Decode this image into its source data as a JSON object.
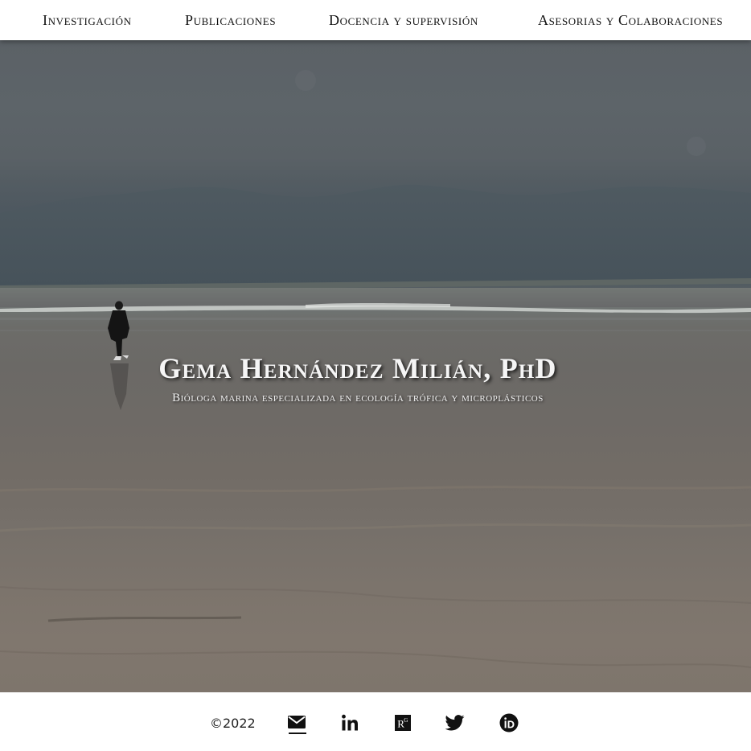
{
  "nav": {
    "items": [
      {
        "label": "Investigación"
      },
      {
        "label": "Publicaciones"
      },
      {
        "label": "Docencia y supervisión"
      },
      {
        "label": "Asesorias y Colaboraciones"
      }
    ]
  },
  "hero": {
    "title": "Gema Hernández Milián, PhD",
    "subtitle": "Bióloga marina especializada en ecología trófica y microplásticos"
  },
  "footer": {
    "copyright": "©2022",
    "social": [
      {
        "icon": "email-icon"
      },
      {
        "icon": "linkedin-icon"
      },
      {
        "icon": "researchgate-icon"
      },
      {
        "icon": "twitter-icon"
      },
      {
        "icon": "orcid-icon"
      }
    ]
  }
}
